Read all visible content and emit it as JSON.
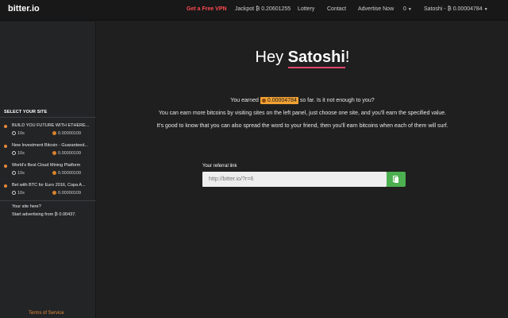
{
  "brand": "bitter.io",
  "nav": {
    "vpn": "Get a Free VPN",
    "jackpot": "Jackpot ₿ 0.20601255",
    "lottery": "Lottery",
    "contact": "Contact",
    "advertise": "Advertise Now",
    "count": "0",
    "user": "Satoshi - ₿ 0.00004784"
  },
  "sidebar": {
    "title": "SELECT YOUR SITE",
    "sites": [
      {
        "name": "BUILD YOU FUTURE WITH ETHERE...",
        "time": "10s",
        "earn": "0.00000109"
      },
      {
        "name": "New Investment Bitcoin - Guaranteed...",
        "time": "10s",
        "earn": "0.00000109"
      },
      {
        "name": "World's Best Cloud Mining Platform",
        "time": "10s",
        "earn": "0.00000109"
      },
      {
        "name": "Bet with BTC for Euro 2016, Copa A...",
        "time": "10s",
        "earn": "0.00000109"
      }
    ],
    "your_site": "Your site here?",
    "start_ad": "Start advertising from ₿ 0.00437.",
    "tos": "Terms of Service"
  },
  "main": {
    "greeting": "Hey ",
    "name": "Satoshi",
    "bang": "!",
    "earned_prefix": "You earned",
    "earned_amount": "0.00004784",
    "earned_suffix": "so far. Is it not enough to you?",
    "line2": "You can earn more bitcoins by visiting sites on the left panel, just choose one site, and you'll earn the specified value.",
    "line3": "It's good to know that you can also spread the word to your friend, then you'll earn bitcoins when each of them will surf.",
    "referral_label": "Your referral link",
    "referral_link": "http://bitter.io/?r=6"
  }
}
